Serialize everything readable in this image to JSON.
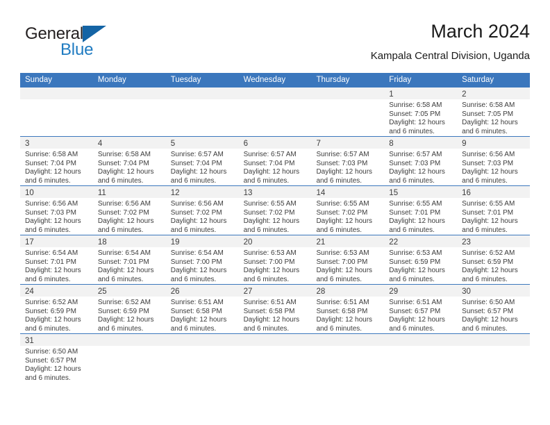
{
  "brand": {
    "name_part1": "General",
    "name_part2": "Blue",
    "flag_icon": "blue-triangle-flag",
    "color_dark": "#231f20",
    "color_blue": "#1f7bc1"
  },
  "header": {
    "title": "March 2024",
    "subtitle": "Kampala Central Division, Uganda"
  },
  "theme": {
    "header_blue": "#3b77bd",
    "day_strip_gray": "#f2f2f2",
    "text_gray": "#3c3c3c"
  },
  "weekdays": [
    "Sunday",
    "Monday",
    "Tuesday",
    "Wednesday",
    "Thursday",
    "Friday",
    "Saturday"
  ],
  "weeks": [
    [
      {
        "day": "",
        "lines": []
      },
      {
        "day": "",
        "lines": []
      },
      {
        "day": "",
        "lines": []
      },
      {
        "day": "",
        "lines": []
      },
      {
        "day": "",
        "lines": []
      },
      {
        "day": "1",
        "lines": [
          "Sunrise: 6:58 AM",
          "Sunset: 7:05 PM",
          "Daylight: 12 hours",
          "and 6 minutes."
        ]
      },
      {
        "day": "2",
        "lines": [
          "Sunrise: 6:58 AM",
          "Sunset: 7:05 PM",
          "Daylight: 12 hours",
          "and 6 minutes."
        ]
      }
    ],
    [
      {
        "day": "3",
        "lines": [
          "Sunrise: 6:58 AM",
          "Sunset: 7:04 PM",
          "Daylight: 12 hours",
          "and 6 minutes."
        ]
      },
      {
        "day": "4",
        "lines": [
          "Sunrise: 6:58 AM",
          "Sunset: 7:04 PM",
          "Daylight: 12 hours",
          "and 6 minutes."
        ]
      },
      {
        "day": "5",
        "lines": [
          "Sunrise: 6:57 AM",
          "Sunset: 7:04 PM",
          "Daylight: 12 hours",
          "and 6 minutes."
        ]
      },
      {
        "day": "6",
        "lines": [
          "Sunrise: 6:57 AM",
          "Sunset: 7:04 PM",
          "Daylight: 12 hours",
          "and 6 minutes."
        ]
      },
      {
        "day": "7",
        "lines": [
          "Sunrise: 6:57 AM",
          "Sunset: 7:03 PM",
          "Daylight: 12 hours",
          "and 6 minutes."
        ]
      },
      {
        "day": "8",
        "lines": [
          "Sunrise: 6:57 AM",
          "Sunset: 7:03 PM",
          "Daylight: 12 hours",
          "and 6 minutes."
        ]
      },
      {
        "day": "9",
        "lines": [
          "Sunrise: 6:56 AM",
          "Sunset: 7:03 PM",
          "Daylight: 12 hours",
          "and 6 minutes."
        ]
      }
    ],
    [
      {
        "day": "10",
        "lines": [
          "Sunrise: 6:56 AM",
          "Sunset: 7:03 PM",
          "Daylight: 12 hours",
          "and 6 minutes."
        ]
      },
      {
        "day": "11",
        "lines": [
          "Sunrise: 6:56 AM",
          "Sunset: 7:02 PM",
          "Daylight: 12 hours",
          "and 6 minutes."
        ]
      },
      {
        "day": "12",
        "lines": [
          "Sunrise: 6:56 AM",
          "Sunset: 7:02 PM",
          "Daylight: 12 hours",
          "and 6 minutes."
        ]
      },
      {
        "day": "13",
        "lines": [
          "Sunrise: 6:55 AM",
          "Sunset: 7:02 PM",
          "Daylight: 12 hours",
          "and 6 minutes."
        ]
      },
      {
        "day": "14",
        "lines": [
          "Sunrise: 6:55 AM",
          "Sunset: 7:02 PM",
          "Daylight: 12 hours",
          "and 6 minutes."
        ]
      },
      {
        "day": "15",
        "lines": [
          "Sunrise: 6:55 AM",
          "Sunset: 7:01 PM",
          "Daylight: 12 hours",
          "and 6 minutes."
        ]
      },
      {
        "day": "16",
        "lines": [
          "Sunrise: 6:55 AM",
          "Sunset: 7:01 PM",
          "Daylight: 12 hours",
          "and 6 minutes."
        ]
      }
    ],
    [
      {
        "day": "17",
        "lines": [
          "Sunrise: 6:54 AM",
          "Sunset: 7:01 PM",
          "Daylight: 12 hours",
          "and 6 minutes."
        ]
      },
      {
        "day": "18",
        "lines": [
          "Sunrise: 6:54 AM",
          "Sunset: 7:01 PM",
          "Daylight: 12 hours",
          "and 6 minutes."
        ]
      },
      {
        "day": "19",
        "lines": [
          "Sunrise: 6:54 AM",
          "Sunset: 7:00 PM",
          "Daylight: 12 hours",
          "and 6 minutes."
        ]
      },
      {
        "day": "20",
        "lines": [
          "Sunrise: 6:53 AM",
          "Sunset: 7:00 PM",
          "Daylight: 12 hours",
          "and 6 minutes."
        ]
      },
      {
        "day": "21",
        "lines": [
          "Sunrise: 6:53 AM",
          "Sunset: 7:00 PM",
          "Daylight: 12 hours",
          "and 6 minutes."
        ]
      },
      {
        "day": "22",
        "lines": [
          "Sunrise: 6:53 AM",
          "Sunset: 6:59 PM",
          "Daylight: 12 hours",
          "and 6 minutes."
        ]
      },
      {
        "day": "23",
        "lines": [
          "Sunrise: 6:52 AM",
          "Sunset: 6:59 PM",
          "Daylight: 12 hours",
          "and 6 minutes."
        ]
      }
    ],
    [
      {
        "day": "24",
        "lines": [
          "Sunrise: 6:52 AM",
          "Sunset: 6:59 PM",
          "Daylight: 12 hours",
          "and 6 minutes."
        ]
      },
      {
        "day": "25",
        "lines": [
          "Sunrise: 6:52 AM",
          "Sunset: 6:59 PM",
          "Daylight: 12 hours",
          "and 6 minutes."
        ]
      },
      {
        "day": "26",
        "lines": [
          "Sunrise: 6:51 AM",
          "Sunset: 6:58 PM",
          "Daylight: 12 hours",
          "and 6 minutes."
        ]
      },
      {
        "day": "27",
        "lines": [
          "Sunrise: 6:51 AM",
          "Sunset: 6:58 PM",
          "Daylight: 12 hours",
          "and 6 minutes."
        ]
      },
      {
        "day": "28",
        "lines": [
          "Sunrise: 6:51 AM",
          "Sunset: 6:58 PM",
          "Daylight: 12 hours",
          "and 6 minutes."
        ]
      },
      {
        "day": "29",
        "lines": [
          "Sunrise: 6:51 AM",
          "Sunset: 6:57 PM",
          "Daylight: 12 hours",
          "and 6 minutes."
        ]
      },
      {
        "day": "30",
        "lines": [
          "Sunrise: 6:50 AM",
          "Sunset: 6:57 PM",
          "Daylight: 12 hours",
          "and 6 minutes."
        ]
      }
    ],
    [
      {
        "day": "31",
        "lines": [
          "Sunrise: 6:50 AM",
          "Sunset: 6:57 PM",
          "Daylight: 12 hours",
          "and 6 minutes."
        ]
      },
      {
        "day": "",
        "lines": []
      },
      {
        "day": "",
        "lines": []
      },
      {
        "day": "",
        "lines": []
      },
      {
        "day": "",
        "lines": []
      },
      {
        "day": "",
        "lines": []
      },
      {
        "day": "",
        "lines": []
      }
    ]
  ]
}
